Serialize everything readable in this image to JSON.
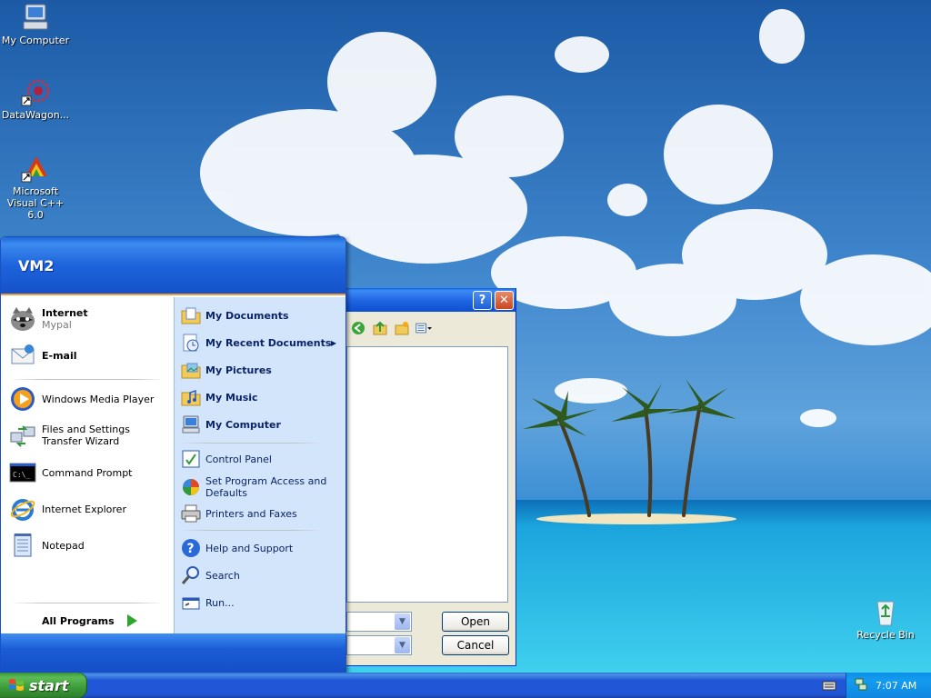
{
  "desktop": {
    "icons": [
      {
        "label": "My Computer",
        "icon": "my-computer-icon"
      },
      {
        "label": "DataWagon...",
        "icon": "datawagon-icon"
      },
      {
        "label": "Microsoft Visual C++ 6.0",
        "icon": "visual-cpp-icon"
      },
      {
        "label": "Recycle Bin",
        "icon": "recycle-bin-icon"
      }
    ]
  },
  "dialog": {
    "help": "?",
    "close": "✕",
    "open_label": "Open",
    "cancel_label": "Cancel"
  },
  "start_menu": {
    "user": "VM2",
    "pinned": [
      {
        "label": "Internet",
        "sub": "Mypal",
        "icon": "raccoon-browser-icon"
      },
      {
        "label": "E-mail",
        "icon": "email-icon"
      }
    ],
    "recent": [
      {
        "label": "Windows Media Player",
        "icon": "media-player-icon"
      },
      {
        "label": "Files and Settings Transfer Wizard",
        "icon": "transfer-wizard-icon"
      },
      {
        "label": "Command Prompt",
        "icon": "command-prompt-icon"
      },
      {
        "label": "Internet Explorer",
        "icon": "internet-explorer-icon"
      },
      {
        "label": "Notepad",
        "icon": "notepad-icon"
      }
    ],
    "all_programs": "All Programs",
    "places": [
      {
        "label": "My Documents",
        "icon": "folder-documents-icon"
      },
      {
        "label": "My Recent Documents",
        "icon": "recent-documents-icon"
      },
      {
        "label": "My Pictures",
        "icon": "folder-pictures-icon"
      },
      {
        "label": "My Music",
        "icon": "folder-music-icon"
      },
      {
        "label": "My Computer",
        "icon": "my-computer-icon"
      }
    ],
    "settings": [
      {
        "label": "Control Panel",
        "icon": "control-panel-icon"
      },
      {
        "label": "Set Program Access and Defaults",
        "icon": "program-defaults-icon"
      },
      {
        "label": "Printers and Faxes",
        "icon": "printer-icon"
      }
    ],
    "tools": [
      {
        "label": "Help and Support",
        "icon": "help-icon"
      },
      {
        "label": "Search",
        "icon": "search-icon"
      },
      {
        "label": "Run...",
        "icon": "run-icon"
      }
    ]
  },
  "taskbar": {
    "start_label": "start",
    "clock": "7:07 AM"
  },
  "colors": {
    "start_green": "#3c9a3a",
    "taskbar_blue": "#2157d7",
    "menu_right_panel": "#d3e5fa"
  }
}
